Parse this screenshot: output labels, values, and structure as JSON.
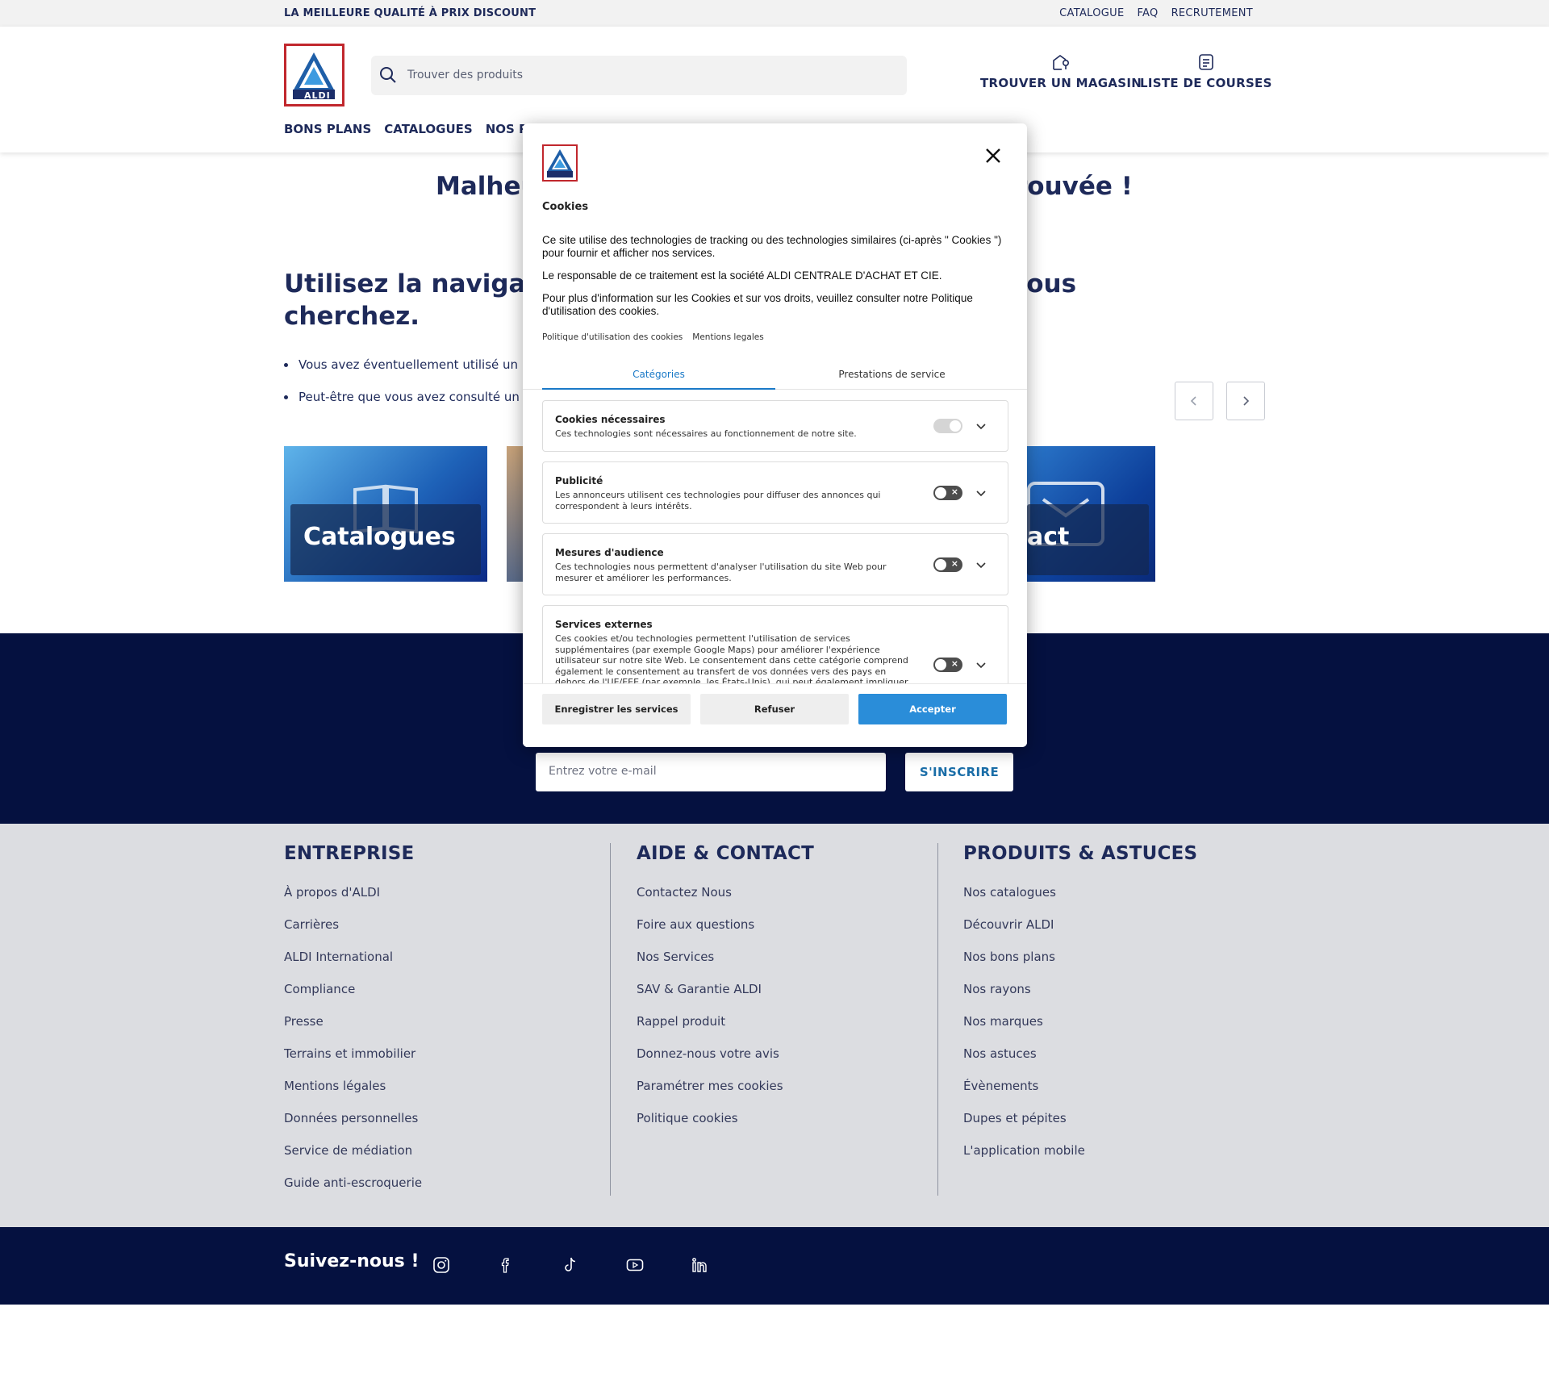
{
  "topbar": {
    "tagline": "LA MEILLEURE QUALITÉ À PRIX DISCOUNT",
    "links": [
      "CATALOGUE",
      "FAQ",
      "RECRUTEMENT"
    ]
  },
  "header": {
    "logo_text": "ALDI",
    "search_placeholder": "Trouver des produits",
    "store_finder": "TROUVER UN MAGASIN",
    "shopping_list": "LISTE DE COURSES",
    "nav": [
      "BONS PLANS",
      "CATALOGUES",
      "NOS RAYO"
    ]
  },
  "content": {
    "error_title_left": "Malheu",
    "error_title_right": "rouvée !",
    "subhead_line1_left": "Utilisez la navigation",
    "subhead_line1_right": "vous",
    "subhead_line2": "cherchez.",
    "bullets": [
      "Vous avez éventuellement utilisé un lien",
      "Peut-être que vous avez consulté un vie"
    ],
    "tiles": [
      {
        "label": "Catalogues",
        "icon": "book-icon"
      },
      {
        "label": "act",
        "icon": "mail-icon"
      }
    ]
  },
  "newsletter": {
    "email_placeholder": "Entrez votre e-mail",
    "subscribe_label": "S'INSCRIRE"
  },
  "footer": {
    "columns": [
      {
        "title": "ENTREPRISE",
        "links": [
          "À propos d'ALDI",
          "Carrières",
          "ALDI International",
          "Compliance",
          "Presse",
          "Terrains et immobilier",
          "Mentions légales",
          "Données personnelles",
          "Service de médiation",
          "Guide anti-escroquerie"
        ]
      },
      {
        "title": "AIDE & CONTACT",
        "links": [
          "Contactez Nous",
          "Foire aux questions",
          "Nos Services",
          "SAV & Garantie ALDI",
          "Rappel produit",
          "Donnez-nous votre avis",
          "Paramétrer mes cookies",
          "Politique cookies"
        ]
      },
      {
        "title": "PRODUITS & ASTUCES",
        "links": [
          "Nos catalogues",
          "Découvrir ALDI",
          "Nos bons plans",
          "Nos rayons",
          "Nos marques",
          "Nos astuces",
          "Évènements",
          "Dupes et pépites",
          "L'application mobile"
        ]
      }
    ],
    "follow": "Suivez-nous !",
    "social_icons": [
      "instagram-icon",
      "facebook-icon",
      "tiktok-icon",
      "youtube-icon",
      "linkedin-icon"
    ]
  },
  "cookie_modal": {
    "title": "Cookies",
    "para1": "Ce site utilise des technologies de tracking ou des technologies similaires (ci-après \" Cookies \") pour fournir et afficher nos services.",
    "para2": "Le responsable de ce traitement est la société ALDI CENTRALE D'ACHAT ET CIE.",
    "para3": "Pour plus d'information sur les Cookies et sur vos droits, veuillez consulter notre Politique d'utilisation des cookies.",
    "links": [
      "Politique d'utilisation des cookies",
      "Mentions legales"
    ],
    "tabs": [
      "Catégories",
      "Prestations de service"
    ],
    "categories": [
      {
        "title": "Cookies nécessaires",
        "desc": "Ces technologies sont nécessaires au fonctionnement de notre site.",
        "enabled": true
      },
      {
        "title": "Publicité",
        "desc": "Les annonceurs utilisent ces technologies pour diffuser des annonces qui correspondent à leurs intérêts.",
        "enabled": false
      },
      {
        "title": "Mesures d'audience",
        "desc": "Ces technologies nous permettent d'analyser l'utilisation du site Web pour mesurer et améliorer les performances.",
        "enabled": false
      },
      {
        "title": "Services externes",
        "desc": "Ces cookies et/ou technologies permettent l'utilisation de services supplémentaires (par exemple Google Maps) pour améliorer l'expérience utilisateur sur notre site Web. Le consentement dans cette catégorie comprend également le consentement au transfert de vos données vers des pays en dehors de l'UE/EEE (par exemple, les États-Unis), qui peut également impliquer certains risques, tels que l'accès à vos",
        "enabled": false
      }
    ],
    "buttons": {
      "save": "Enregistrer les services",
      "refuse": "Refuser",
      "accept": "Accepter"
    },
    "accent_color": "#2a8dd9"
  }
}
